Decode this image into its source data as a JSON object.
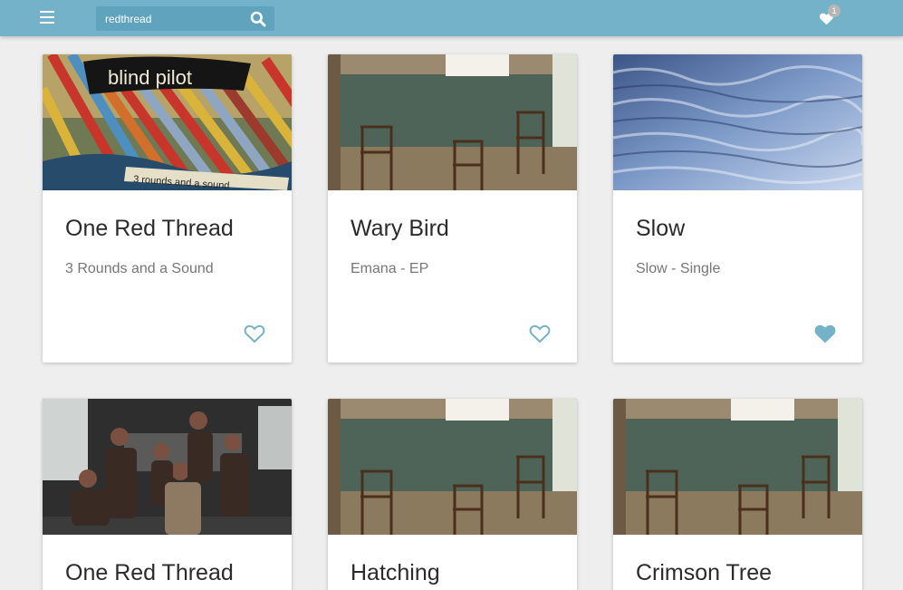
{
  "search": {
    "value": "redthread"
  },
  "favorites": {
    "count": "1"
  },
  "colors": {
    "topbar": "#73b2c9",
    "heart": "#73b2c9"
  },
  "cards": [
    {
      "title": "One Red Thread",
      "subtitle": "3 Rounds and a Sound",
      "cover_text_top": "blind pilot",
      "cover_text_bottom": "3 rounds and a sound",
      "favorited": false
    },
    {
      "title": "Wary Bird",
      "subtitle": "Emana - EP",
      "favorited": false
    },
    {
      "title": "Slow",
      "subtitle": "Slow - Single",
      "favorited": true
    },
    {
      "title": "One Red Thread"
    },
    {
      "title": "Hatching"
    },
    {
      "title": "Crimson Tree"
    }
  ]
}
